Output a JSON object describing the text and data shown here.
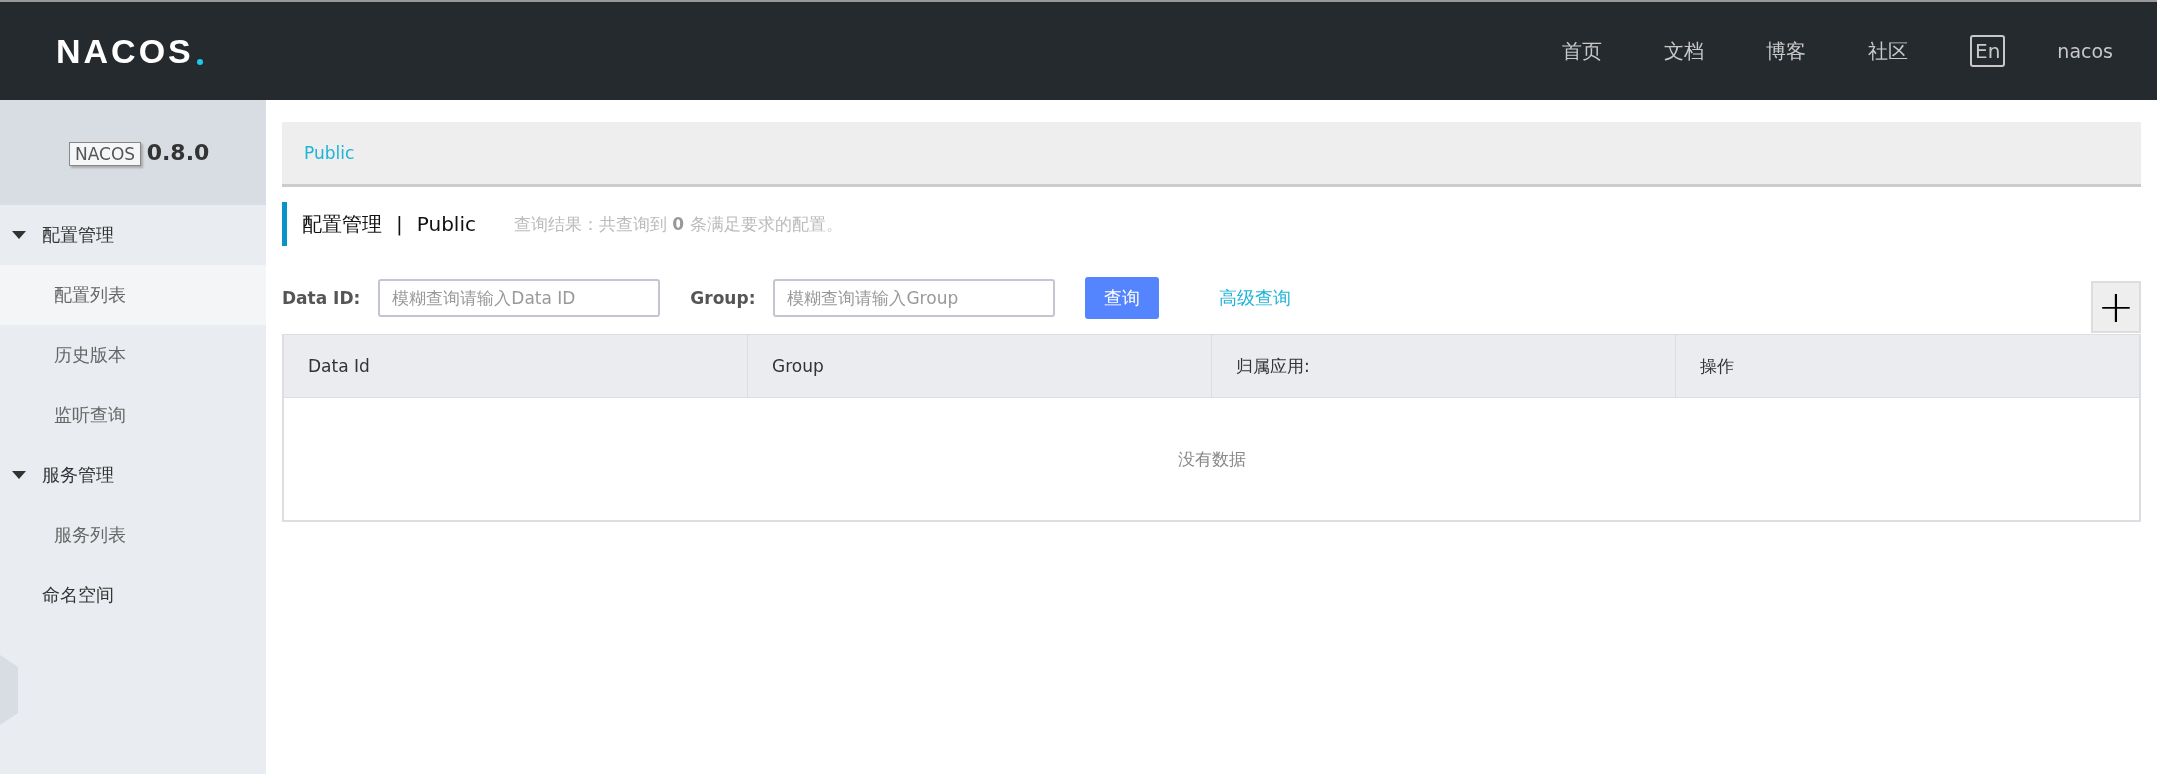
{
  "header": {
    "logo": "NACOS",
    "nav": [
      "首页",
      "文档",
      "博客",
      "社区"
    ],
    "language": "En",
    "user": "nacos"
  },
  "sidebar": {
    "version": "0.8.0",
    "tooltip": "NACOS",
    "items": [
      {
        "label": "配置管理",
        "expanded": true,
        "children": [
          {
            "label": "配置列表",
            "selected": true
          },
          {
            "label": "历史版本",
            "selected": false
          },
          {
            "label": "监听查询",
            "selected": false
          }
        ]
      },
      {
        "label": "服务管理",
        "expanded": true,
        "children": [
          {
            "label": "服务列表",
            "selected": false
          }
        ]
      },
      {
        "label": "命名空间"
      }
    ]
  },
  "namespace_tabs": [
    {
      "label": "Public",
      "selected": true
    }
  ],
  "page_title": {
    "section": "配置管理",
    "separator": "|",
    "namespace": "Public",
    "result": "查询结果：共查询到 **0** 条满足要求的配置。"
  },
  "search": {
    "fields": [
      {
        "label": "Data ID:",
        "placeholder": "模糊查询请输入Data ID"
      },
      {
        "label": "Group:",
        "placeholder": "模糊查询请输入Group"
      }
    ],
    "button": "查询",
    "advanced": "高级查询",
    "add": "+"
  },
  "table": {
    "columns": [
      "Data Id",
      "Group",
      "归属应用:",
      "操作"
    ],
    "empty": "没有数据"
  }
}
